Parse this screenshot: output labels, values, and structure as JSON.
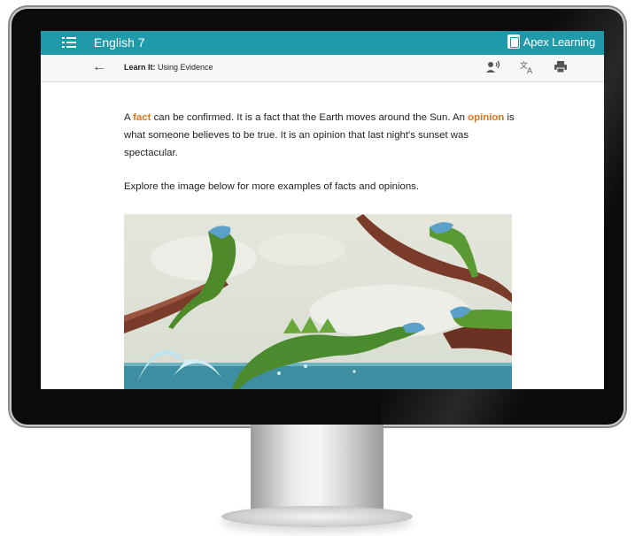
{
  "header": {
    "course_title": "English 7",
    "brand_name": "Apex Learning"
  },
  "subheader": {
    "lesson_label": "Learn It:",
    "lesson_title": "Using Evidence",
    "tools": [
      "read-aloud-icon",
      "translate-icon",
      "print-icon"
    ]
  },
  "content": {
    "p1_a": "A ",
    "fact_word": "fact",
    "p1_b": " can be confirmed. It is a fact that the Earth moves around the Sun. An ",
    "opinion_word": "opinion",
    "p1_c": " is what someone believes to be true. It is an opinion that last night's sunset was spectacular.",
    "p2": "Explore the image below for more examples of facts and opinions."
  },
  "colors": {
    "header_bg": "#1f9aab",
    "highlight": "#e2731c"
  }
}
